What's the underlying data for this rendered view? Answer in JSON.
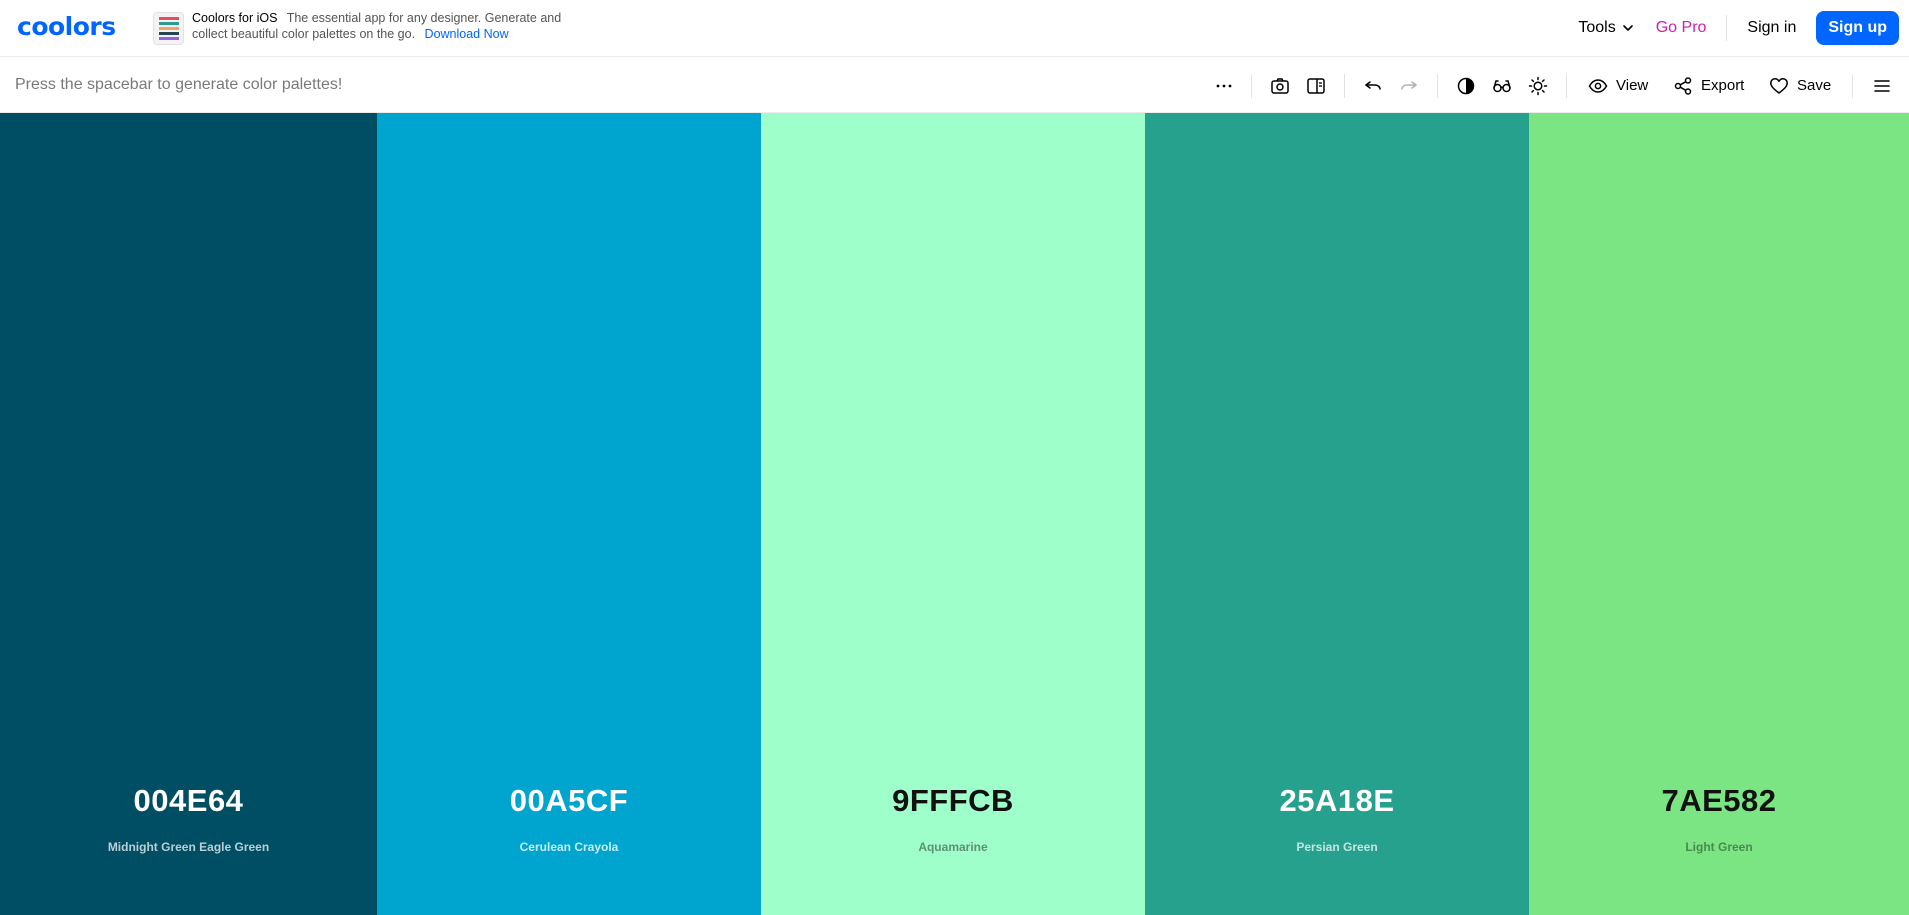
{
  "header": {
    "logo": "coolors",
    "promo": {
      "title": "Coolors for iOS",
      "text": "The essential app for any designer. Generate and collect beautiful color palettes on the go.",
      "link": "Download Now"
    },
    "nav": {
      "tools": "Tools",
      "go_pro": "Go Pro",
      "sign_in": "Sign in",
      "sign_up": "Sign up"
    }
  },
  "toolbar": {
    "hint": "Press the spacebar to generate color palettes!",
    "view_label": "View",
    "export_label": "Export",
    "save_label": "Save"
  },
  "icons": [
    "more-icon",
    "camera-icon",
    "sidebar-panel-icon",
    "undo-icon",
    "redo-icon",
    "contrast-icon",
    "glasses-icon",
    "sun-icon",
    "eye-icon",
    "share-icon",
    "heart-icon",
    "hamburger-menu-icon",
    "chevron-down-icon"
  ],
  "colors": {
    "brand": "#0066ff",
    "go_pro": "#d21ea5"
  },
  "palette": [
    {
      "hex": "004E64",
      "name": "Midnight Green Eagle Green",
      "bg": "#004e64",
      "text": "#ffffff",
      "sub": "#b8cfd6"
    },
    {
      "hex": "00A5CF",
      "name": "Cerulean Crayola",
      "bg": "#00a5cf",
      "text": "#ffffff",
      "sub": "#c6ecf6"
    },
    {
      "hex": "9FFFCB",
      "name": "Aquamarine",
      "bg": "#9fffcb",
      "text": "#111111",
      "sub": "#5d8f74"
    },
    {
      "hex": "25A18E",
      "name": "Persian Green",
      "bg": "#25a18e",
      "text": "#ffffff",
      "sub": "#c3e6e0"
    },
    {
      "hex": "7AE582",
      "name": "Light Green",
      "bg": "#7ae582",
      "text": "#111111",
      "sub": "#4a8a4f"
    }
  ]
}
